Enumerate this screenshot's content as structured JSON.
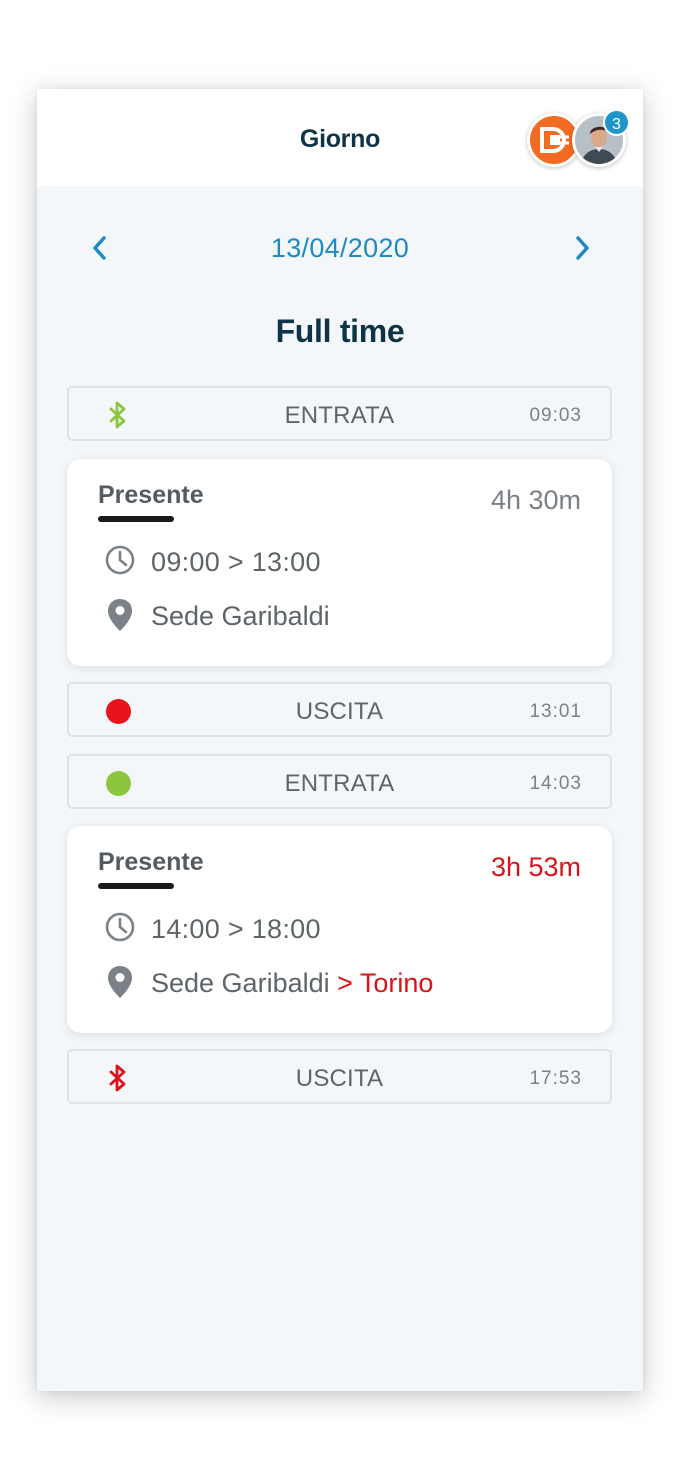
{
  "header": {
    "title": "Giorno",
    "notification_count": "3"
  },
  "date_nav": {
    "date": "13/04/2020"
  },
  "schedule": {
    "title": "Full time"
  },
  "colors": {
    "accent": "#1e8ac2",
    "in": "#8cc63f",
    "out": "#d9131a",
    "title": "#0f3447",
    "logo": "#f26b21"
  },
  "events": [
    {
      "type": "ENTRATA",
      "time": "09:03",
      "icon": "bluetooth-icon-green"
    },
    {
      "type": "USCITA",
      "time": "13:01",
      "icon": "red-dot"
    },
    {
      "type": "ENTRATA",
      "time": "14:03",
      "icon": "green-dot"
    },
    {
      "type": "USCITA",
      "time": "17:53",
      "icon": "bluetooth-icon-red"
    }
  ],
  "shifts": [
    {
      "status": "Presente",
      "duration": "4h 30m",
      "hours": "09:00 > 13:00",
      "location": "Sede Garibaldi",
      "location_extra": ""
    },
    {
      "status": "Presente",
      "duration": "3h 53m",
      "hours": "14:00 > 18:00",
      "location": "Sede Garibaldi",
      "location_extra": " > Torino"
    }
  ]
}
